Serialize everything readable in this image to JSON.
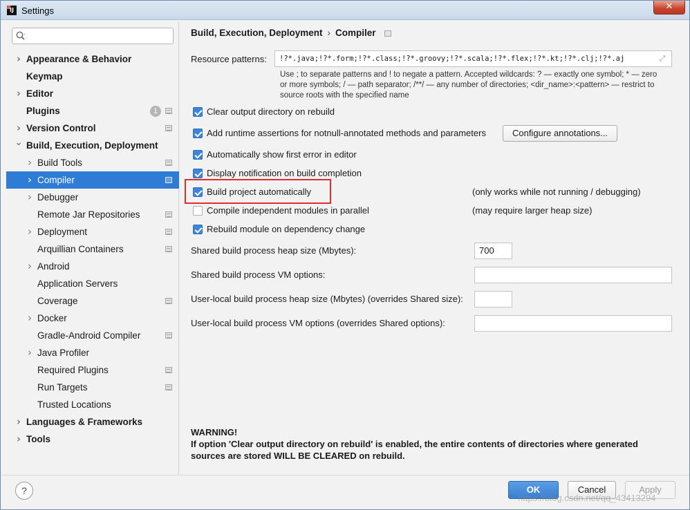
{
  "window": {
    "title": "Settings",
    "close_symbol": "✕",
    "colors": {
      "selection": "#2e7cd5",
      "accent_button": "#3a7fd0",
      "highlight_box": "#e12a2a"
    }
  },
  "search": {
    "value": "",
    "placeholder": ""
  },
  "sidebar": {
    "items": [
      {
        "label": "Appearance & Behavior",
        "level": 0,
        "expandable": true,
        "bold": true
      },
      {
        "label": "Keymap",
        "level": 0,
        "expandable": false,
        "bold": true
      },
      {
        "label": "Editor",
        "level": 0,
        "expandable": true,
        "bold": true
      },
      {
        "label": "Plugins",
        "level": 0,
        "expandable": false,
        "bold": true,
        "badge": "1",
        "page_icon": true
      },
      {
        "label": "Version Control",
        "level": 0,
        "expandable": true,
        "bold": true,
        "page_icon": true
      },
      {
        "label": "Build, Execution, Deployment",
        "level": 0,
        "expandable": true,
        "expanded": true,
        "bold": true
      },
      {
        "label": "Build Tools",
        "level": 1,
        "expandable": true,
        "page_icon": true
      },
      {
        "label": "Compiler",
        "level": 1,
        "expandable": true,
        "page_icon": true,
        "selected": true
      },
      {
        "label": "Debugger",
        "level": 1,
        "expandable": true
      },
      {
        "label": "Remote Jar Repositories",
        "level": 1,
        "expandable": false,
        "page_icon": true
      },
      {
        "label": "Deployment",
        "level": 1,
        "expandable": true,
        "page_icon": true
      },
      {
        "label": "Arquillian Containers",
        "level": 1,
        "expandable": false,
        "page_icon": true
      },
      {
        "label": "Android",
        "level": 1,
        "expandable": true
      },
      {
        "label": "Application Servers",
        "level": 1,
        "expandable": false
      },
      {
        "label": "Coverage",
        "level": 1,
        "expandable": false,
        "page_icon": true
      },
      {
        "label": "Docker",
        "level": 1,
        "expandable": true
      },
      {
        "label": "Gradle-Android Compiler",
        "level": 1,
        "expandable": false,
        "page_icon": true
      },
      {
        "label": "Java Profiler",
        "level": 1,
        "expandable": true
      },
      {
        "label": "Required Plugins",
        "level": 1,
        "expandable": false,
        "page_icon": true
      },
      {
        "label": "Run Targets",
        "level": 1,
        "expandable": false,
        "page_icon": true
      },
      {
        "label": "Trusted Locations",
        "level": 1,
        "expandable": false
      },
      {
        "label": "Languages & Frameworks",
        "level": 0,
        "expandable": true,
        "bold": true
      },
      {
        "label": "Tools",
        "level": 0,
        "expandable": true,
        "bold": true
      }
    ]
  },
  "breadcrumb": {
    "parent": "Build, Execution, Deployment",
    "separator": "›",
    "current": "Compiler"
  },
  "compiler": {
    "resource_patterns_label": "Resource patterns:",
    "resource_patterns_value": "!?*.java;!?*.form;!?*.class;!?*.groovy;!?*.scala;!?*.flex;!?*.kt;!?*.clj;!?*.aj",
    "hint_line1": "Use ; to separate patterns and ! to negate a pattern. Accepted wildcards: ? — exactly one symbol; * — zero",
    "hint_line2": "or more symbols; / — path separator; /**/ — any number of directories; <dir_name>:<pattern> — restrict to",
    "hint_line3": "source roots with the specified name",
    "checkboxes": [
      {
        "label": "Clear output directory on rebuild",
        "checked": true
      },
      {
        "label": "Add runtime assertions for notnull-annotated methods and parameters",
        "checked": true
      },
      {
        "label": "Automatically show first error in editor",
        "checked": true
      },
      {
        "label": "Display notification on build completion",
        "checked": true
      },
      {
        "label": "Build project automatically",
        "checked": true
      },
      {
        "label": "Compile independent modules in parallel",
        "checked": false
      },
      {
        "label": "Rebuild module on dependency change",
        "checked": true
      }
    ],
    "configure_annotations_label": "Configure annotations...",
    "note_build_auto": "(only works while not running / debugging)",
    "note_parallel": "(may require larger heap size)",
    "heap_size_label": "Shared build process heap size (Mbytes):",
    "heap_size_value": "700",
    "vm_options_label": "Shared build process VM options:",
    "vm_options_value": "",
    "local_heap_label": "User-local build process heap size (Mbytes) (overrides Shared size):",
    "local_heap_value": "",
    "local_vm_label": "User-local build process VM options (overrides Shared options):",
    "local_vm_value": "",
    "warning_title": "WARNING!",
    "warning_text": "If option 'Clear output directory on rebuild' is enabled, the entire contents of directories where generated sources are stored WILL BE CLEARED on rebuild."
  },
  "footer": {
    "help_label": "?",
    "ok_label": "OK",
    "cancel_label": "Cancel",
    "apply_label": "Apply",
    "watermark": "https://blog.csdn.net/qq_43413294"
  }
}
